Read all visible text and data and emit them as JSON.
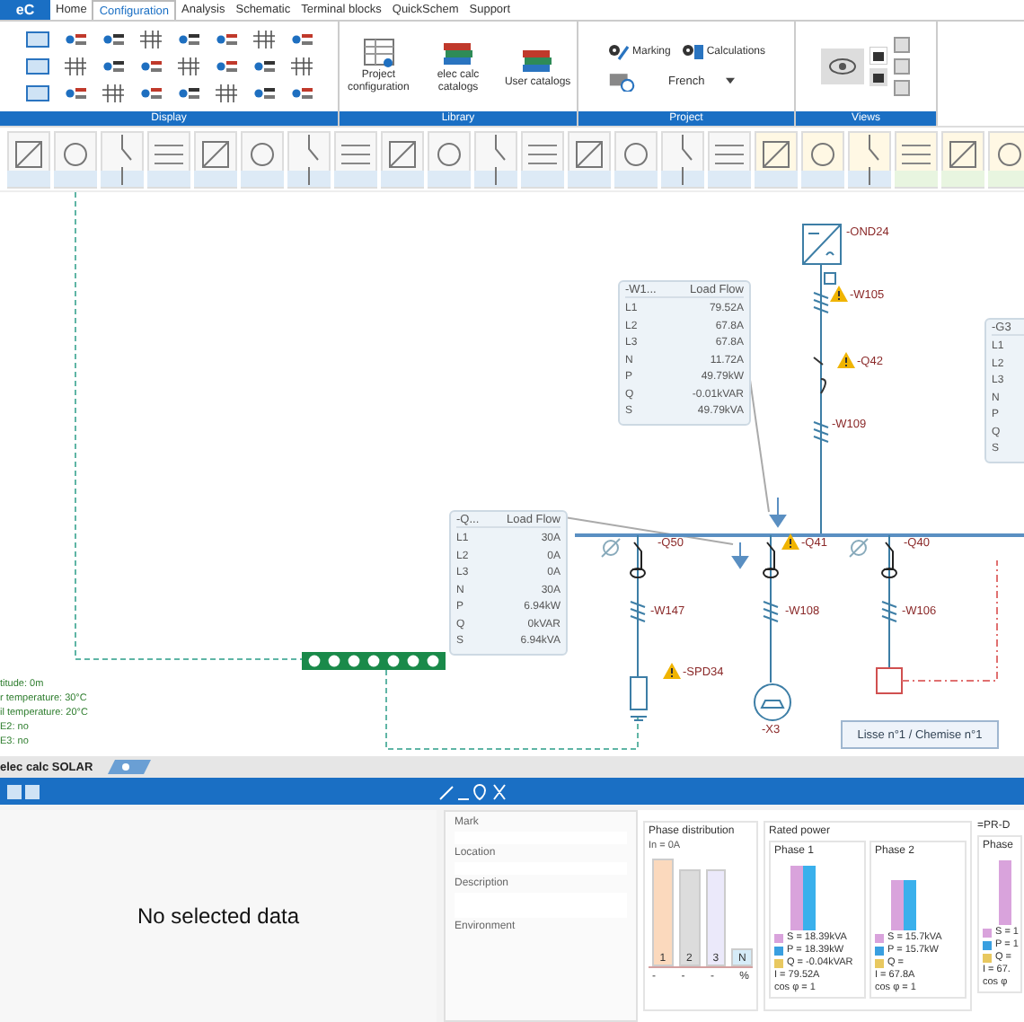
{
  "app_logo": "eC",
  "menu_tabs": [
    {
      "label": "Home",
      "selected": false
    },
    {
      "label": "Configuration",
      "selected": true
    },
    {
      "label": "Analysis",
      "selected": false
    },
    {
      "label": "Schematic",
      "selected": false
    },
    {
      "label": "Terminal blocks",
      "selected": false
    },
    {
      "label": "QuickSchem",
      "selected": false
    },
    {
      "label": "Support",
      "selected": false
    }
  ],
  "ribbon_groups": [
    {
      "kind": "tools",
      "title": "Display"
    },
    {
      "kind": "large",
      "title": "Library",
      "buttons": [
        "Project configuration",
        "elec calc catalogs",
        "User catalogs"
      ]
    },
    {
      "kind": "project",
      "title": "Project",
      "buttons": [
        "Marking",
        "Calculations"
      ],
      "language": "French"
    },
    {
      "kind": "views",
      "title": "Views"
    }
  ],
  "diagram": {
    "labels": [
      {
        "text": "-OND24",
        "warning": false
      },
      {
        "text": "-W105",
        "warning": true
      },
      {
        "text": "-Q42",
        "warning": true
      },
      {
        "text": "-W109",
        "warning": false
      },
      {
        "text": "-Q50",
        "warning": false
      },
      {
        "text": "-Q41",
        "warning": true
      },
      {
        "text": "-Q40",
        "warning": false
      },
      {
        "text": "-W147",
        "warning": false
      },
      {
        "text": "-W108",
        "warning": false
      },
      {
        "text": "-W106",
        "warning": false
      },
      {
        "text": "-SPD34",
        "warning": true
      },
      {
        "text": "-X3",
        "warning": false
      }
    ],
    "load_flow_panels": [
      {
        "mark": "-W1...",
        "title": "Load Flow",
        "rows": [
          {
            "name": "L1",
            "value": "79.52A"
          },
          {
            "name": "L2",
            "value": "67.8A"
          },
          {
            "name": "L3",
            "value": "67.8A"
          },
          {
            "name": "N",
            "value": "11.72A"
          },
          {
            "name": "P",
            "value": "49.79kW"
          },
          {
            "name": "Q",
            "value": "-0.01kVAR"
          },
          {
            "name": "S",
            "value": "49.79kVA"
          }
        ]
      },
      {
        "mark": "-Q...",
        "title": "Load Flow",
        "rows": [
          {
            "name": "L1",
            "value": "30A"
          },
          {
            "name": "L2",
            "value": "0A"
          },
          {
            "name": "L3",
            "value": "0A"
          },
          {
            "name": "N",
            "value": "30A"
          },
          {
            "name": "P",
            "value": "6.94kW"
          },
          {
            "name": "Q",
            "value": "0kVAR"
          },
          {
            "name": "S",
            "value": "6.94kVA"
          }
        ]
      },
      {
        "mark": "-G3",
        "rows": [
          {
            "name": "L1"
          },
          {
            "name": "L2"
          },
          {
            "name": "L3"
          },
          {
            "name": "N"
          },
          {
            "name": "P"
          },
          {
            "name": "Q"
          },
          {
            "name": "S"
          }
        ]
      }
    ],
    "info_lines": [
      "titude: 0m",
      "r temperature: 30°C",
      "il temperature: 20°C",
      "E2: no",
      "E3: no"
    ],
    "set_label": "Lisse n°1 / Chemise n°1"
  },
  "document_tab": "elec calc SOLAR",
  "detail": {
    "empty_message": "No selected data",
    "fields": [
      {
        "label": "Mark"
      },
      {
        "label": "Location"
      },
      {
        "label": "Description"
      },
      {
        "label": "Environment"
      }
    ]
  },
  "phase_distribution": {
    "title": "Phase distribution",
    "legend": "In = 0A",
    "bars": [
      {
        "label": "1",
        "color": "#fbd9bd"
      },
      {
        "label": "2",
        "color": "#dcdcdc"
      },
      {
        "label": "3",
        "color": "#ebe9fa"
      },
      {
        "label": "N",
        "color": "#d6ecf8"
      }
    ],
    "axis_labels": [
      "-",
      "-",
      "-",
      "%"
    ]
  },
  "rated_power": {
    "title": "Rated power",
    "phases": [
      {
        "title": "Phase 1",
        "lines": [
          {
            "kind": "swatch",
            "color": "#d9a3dc",
            "text": "S = 18.39kVA"
          },
          {
            "kind": "swatch",
            "color": "#3a9fe0",
            "text": "P = 18.39kW"
          },
          {
            "kind": "swatch",
            "color": "#e8c860",
            "text": "Q = -0.04kVAR"
          },
          {
            "kind": "plain",
            "text": "I = 79.52A"
          },
          {
            "kind": "plain",
            "text": "cos φ = 1"
          }
        ]
      },
      {
        "title": "Phase 2",
        "lines": [
          {
            "kind": "swatch",
            "color": "#d9a3dc",
            "text": "S = 15.7kVA"
          },
          {
            "kind": "swatch",
            "color": "#3a9fe0",
            "text": "P = 15.7kW"
          },
          {
            "kind": "swatch",
            "color": "#e8c860",
            "text": "Q ="
          },
          {
            "kind": "plain",
            "text": "I = 67.8A"
          },
          {
            "kind": "plain",
            "text": "cos φ = 1"
          }
        ]
      }
    ],
    "next_title": "=PR-D",
    "next_phase": {
      "title": "Phase",
      "lines": [
        {
          "kind": "swatch",
          "color": "#d9a3dc",
          "text": "S = 1"
        },
        {
          "kind": "swatch",
          "color": "#3a9fe0",
          "text": "P = 1"
        },
        {
          "kind": "swatch",
          "color": "#e8c860",
          "text": "Q ="
        },
        {
          "kind": "plain",
          "text": "I = 67."
        },
        {
          "kind": "plain",
          "text": "cos φ"
        }
      ]
    }
  }
}
